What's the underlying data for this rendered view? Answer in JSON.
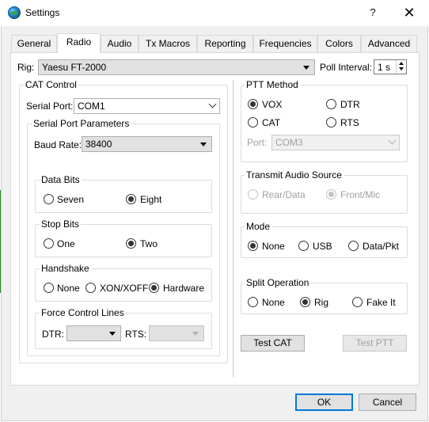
{
  "window": {
    "title": "Settings",
    "help_label": "?",
    "close_label": "✕",
    "icon": "globe-icon"
  },
  "tabs": [
    "General",
    "Radio",
    "Audio",
    "Tx Macros",
    "Reporting",
    "Frequencies",
    "Colors",
    "Advanced"
  ],
  "active_tab": "Radio",
  "rig": {
    "label": "Rig:",
    "value": "Yaesu FT-2000"
  },
  "poll": {
    "label": "Poll Interval:",
    "value": "1 s"
  },
  "cat_control": {
    "title": "CAT Control",
    "serial_port_label": "Serial Port:",
    "serial_port_value": "COM1",
    "params_title": "Serial Port Parameters",
    "baud_label": "Baud Rate:",
    "baud_value": "38400",
    "data_bits": {
      "title": "Data Bits",
      "options": [
        "Seven",
        "Eight"
      ],
      "selected": "Eight"
    },
    "stop_bits": {
      "title": "Stop Bits",
      "options": [
        "One",
        "Two"
      ],
      "selected": "Two"
    },
    "handshake": {
      "title": "Handshake",
      "options": [
        "None",
        "XON/XOFF",
        "Hardware"
      ],
      "selected": "Hardware"
    },
    "force_lines": {
      "title": "Force Control Lines",
      "dtr_label": "DTR:",
      "rts_label": "RTS:",
      "dtr_value": "",
      "rts_value": ""
    }
  },
  "ptt": {
    "title": "PTT Method",
    "options": [
      "VOX",
      "DTR",
      "CAT",
      "RTS"
    ],
    "selected": "VOX",
    "port_label": "Port:",
    "port_value": "COM3"
  },
  "tx_audio": {
    "title": "Transmit Audio Source",
    "options": [
      "Rear/Data",
      "Front/Mic"
    ],
    "selected": "Front/Mic"
  },
  "mode": {
    "title": "Mode",
    "options": [
      "None",
      "USB",
      "Data/Pkt"
    ],
    "selected": "None"
  },
  "split": {
    "title": "Split Operation",
    "options": [
      "None",
      "Rig",
      "Fake It"
    ],
    "selected": "Rig"
  },
  "buttons": {
    "test_cat": "Test CAT",
    "test_ptt": "Test PTT",
    "ok": "OK",
    "cancel": "Cancel"
  },
  "colors": {
    "accent": "#0078d7",
    "window_bg": "#f0f0f0",
    "panel_bg": "#ffffff"
  }
}
